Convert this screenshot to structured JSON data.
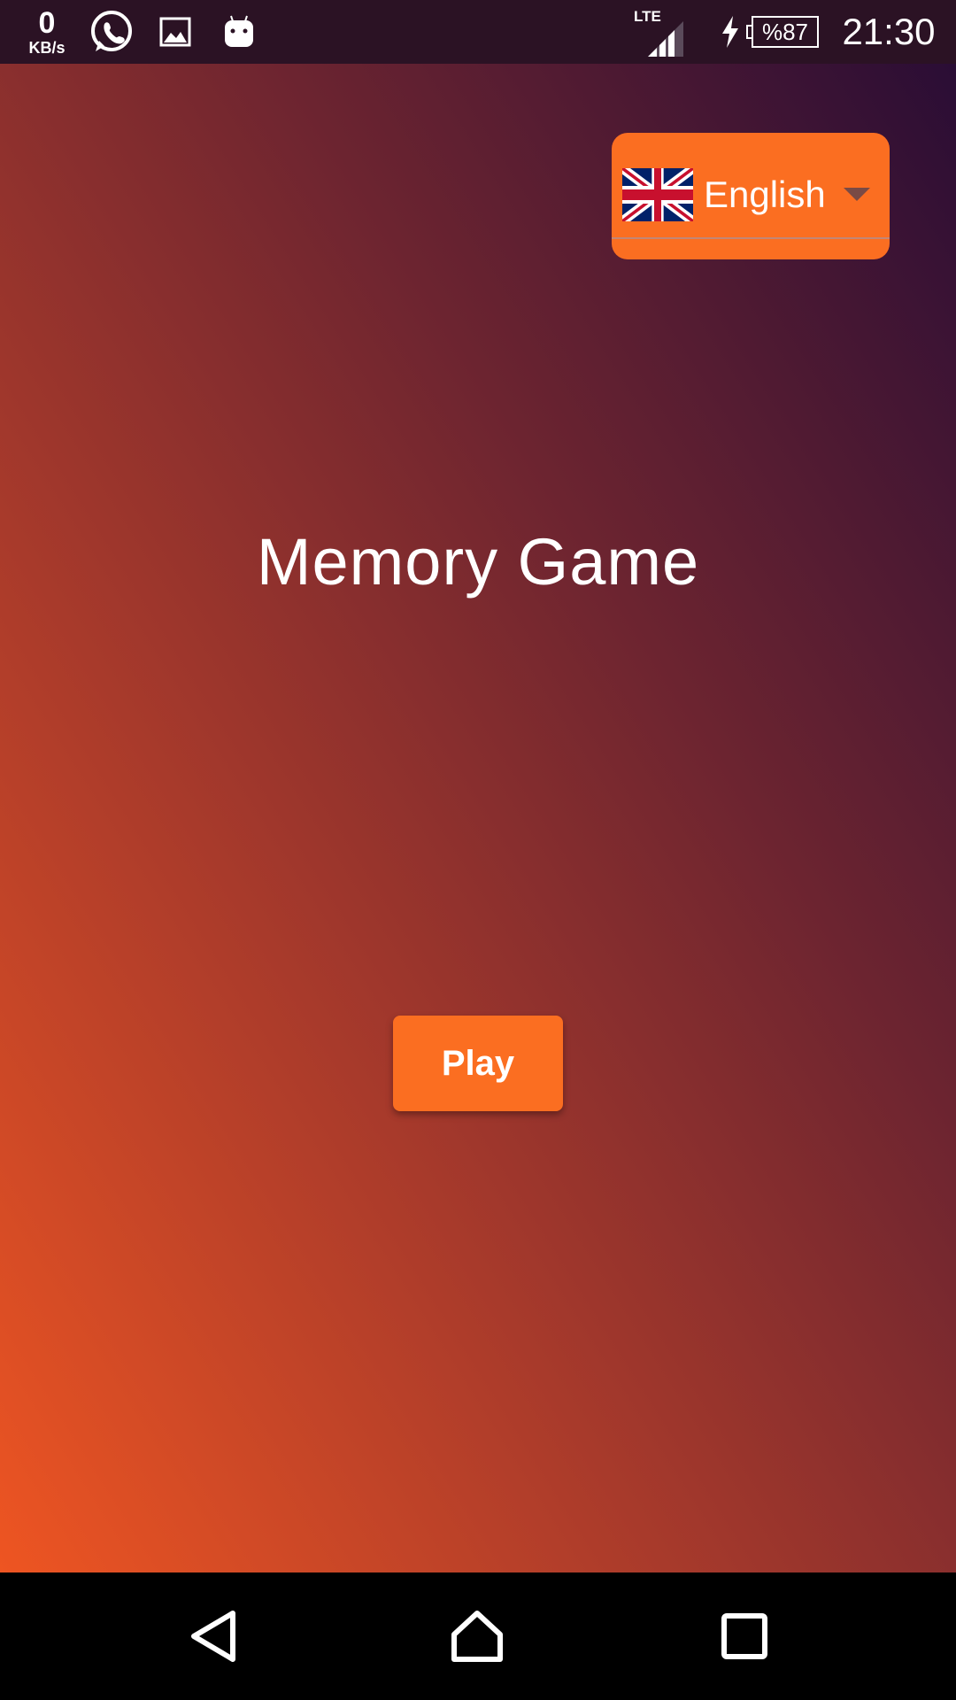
{
  "status_bar": {
    "net_speed_value": "0",
    "net_speed_unit": "KB/s",
    "network_type": "LTE",
    "battery_text": "%87",
    "time": "21:30",
    "icons": [
      "whatsapp-icon",
      "gallery-icon",
      "android-icon",
      "signal-icon",
      "charging-icon",
      "battery-icon"
    ]
  },
  "language_selector": {
    "selected": "English",
    "flag": "uk-flag-icon"
  },
  "title": "Memory Game",
  "play_button": {
    "label": "Play"
  },
  "nav_bar": {
    "icons": [
      "back-icon",
      "home-icon",
      "recent-apps-icon"
    ]
  },
  "colors": {
    "accent": "#fb6e21",
    "gradient_start": "#ee5522",
    "gradient_end": "#2a0d35",
    "status_bar": "#2b1224"
  }
}
